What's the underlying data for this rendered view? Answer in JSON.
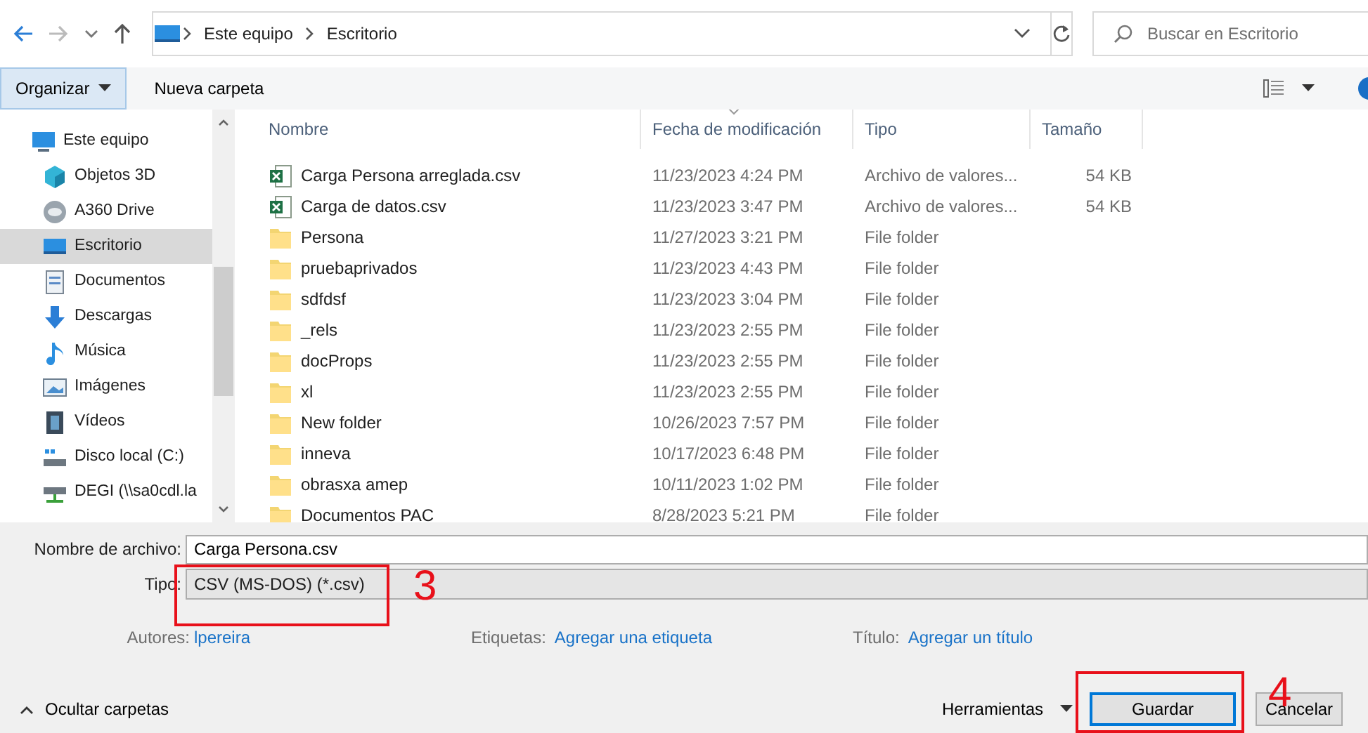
{
  "nav": {
    "path": [
      "Este equipo",
      "Escritorio"
    ],
    "search": {
      "placeholder": "Buscar en Escritorio"
    }
  },
  "toolbar": {
    "organize": "Organizar",
    "new_folder": "Nueva carpeta"
  },
  "sidebar": {
    "items": [
      {
        "label": "Este equipo",
        "selected": false
      },
      {
        "label": "Objetos 3D",
        "selected": false
      },
      {
        "label": "A360 Drive",
        "selected": false
      },
      {
        "label": "Escritorio",
        "selected": true
      },
      {
        "label": "Documentos",
        "selected": false
      },
      {
        "label": "Descargas",
        "selected": false
      },
      {
        "label": "Música",
        "selected": false
      },
      {
        "label": "Imágenes",
        "selected": false
      },
      {
        "label": "Vídeos",
        "selected": false
      },
      {
        "label": "Disco local (C:)",
        "selected": false
      },
      {
        "label": "DEGI (\\\\sa0cdl.la",
        "selected": false
      }
    ]
  },
  "columns": [
    "Nombre",
    "Fecha de modificación",
    "Tipo",
    "Tamaño"
  ],
  "files": [
    {
      "name": "Carga Persona arreglada.csv",
      "kind": "csv",
      "modified": "11/23/2023 4:24 PM",
      "type": "Archivo de valores...",
      "size": "54 KB"
    },
    {
      "name": "Carga de datos.csv",
      "kind": "csv",
      "modified": "11/23/2023 3:47 PM",
      "type": "Archivo de valores...",
      "size": "54 KB"
    },
    {
      "name": "Persona",
      "kind": "folder",
      "modified": "11/27/2023 3:21 PM",
      "type": "File folder"
    },
    {
      "name": "pruebaprivados",
      "kind": "folder",
      "modified": "11/23/2023 4:43 PM",
      "type": "File folder"
    },
    {
      "name": "sdfdsf",
      "kind": "folder",
      "modified": "11/23/2023 3:04 PM",
      "type": "File folder"
    },
    {
      "name": "_rels",
      "kind": "folder",
      "modified": "11/23/2023 2:55 PM",
      "type": "File folder"
    },
    {
      "name": "docProps",
      "kind": "folder",
      "modified": "11/23/2023 2:55 PM",
      "type": "File folder"
    },
    {
      "name": "xl",
      "kind": "folder",
      "modified": "11/23/2023 2:55 PM",
      "type": "File folder"
    },
    {
      "name": "New folder",
      "kind": "folder",
      "modified": "10/26/2023 7:57 PM",
      "type": "File folder"
    },
    {
      "name": "inneva",
      "kind": "folder",
      "modified": "10/17/2023 6:48 PM",
      "type": "File folder"
    },
    {
      "name": "obrasxa amep",
      "kind": "folder",
      "modified": "10/11/2023 1:02 PM",
      "type": "File folder"
    },
    {
      "name": "Documentos PAC",
      "kind": "folder",
      "modified": "8/28/2023 5:21 PM",
      "type": "File folder"
    }
  ],
  "form": {
    "file_name_label": "Nombre de archivo:",
    "file_name": "Carga Persona.csv",
    "type_label": "Tipo:",
    "type_value": "CSV (MS-DOS) (*.csv)",
    "meta": [
      {
        "label": "Autores:",
        "value": "lpereira"
      },
      {
        "label": "Etiquetas:",
        "value": "Agregar una etiqueta"
      },
      {
        "label": "Título:",
        "value": "Agregar un título"
      }
    ]
  },
  "footer": {
    "toggle": "Ocultar carpetas",
    "tools": "Herramientas",
    "save": "Guardar",
    "cancel": "Cancelar"
  },
  "annotations": [
    {
      "number": "3"
    },
    {
      "number": "4"
    }
  ]
}
